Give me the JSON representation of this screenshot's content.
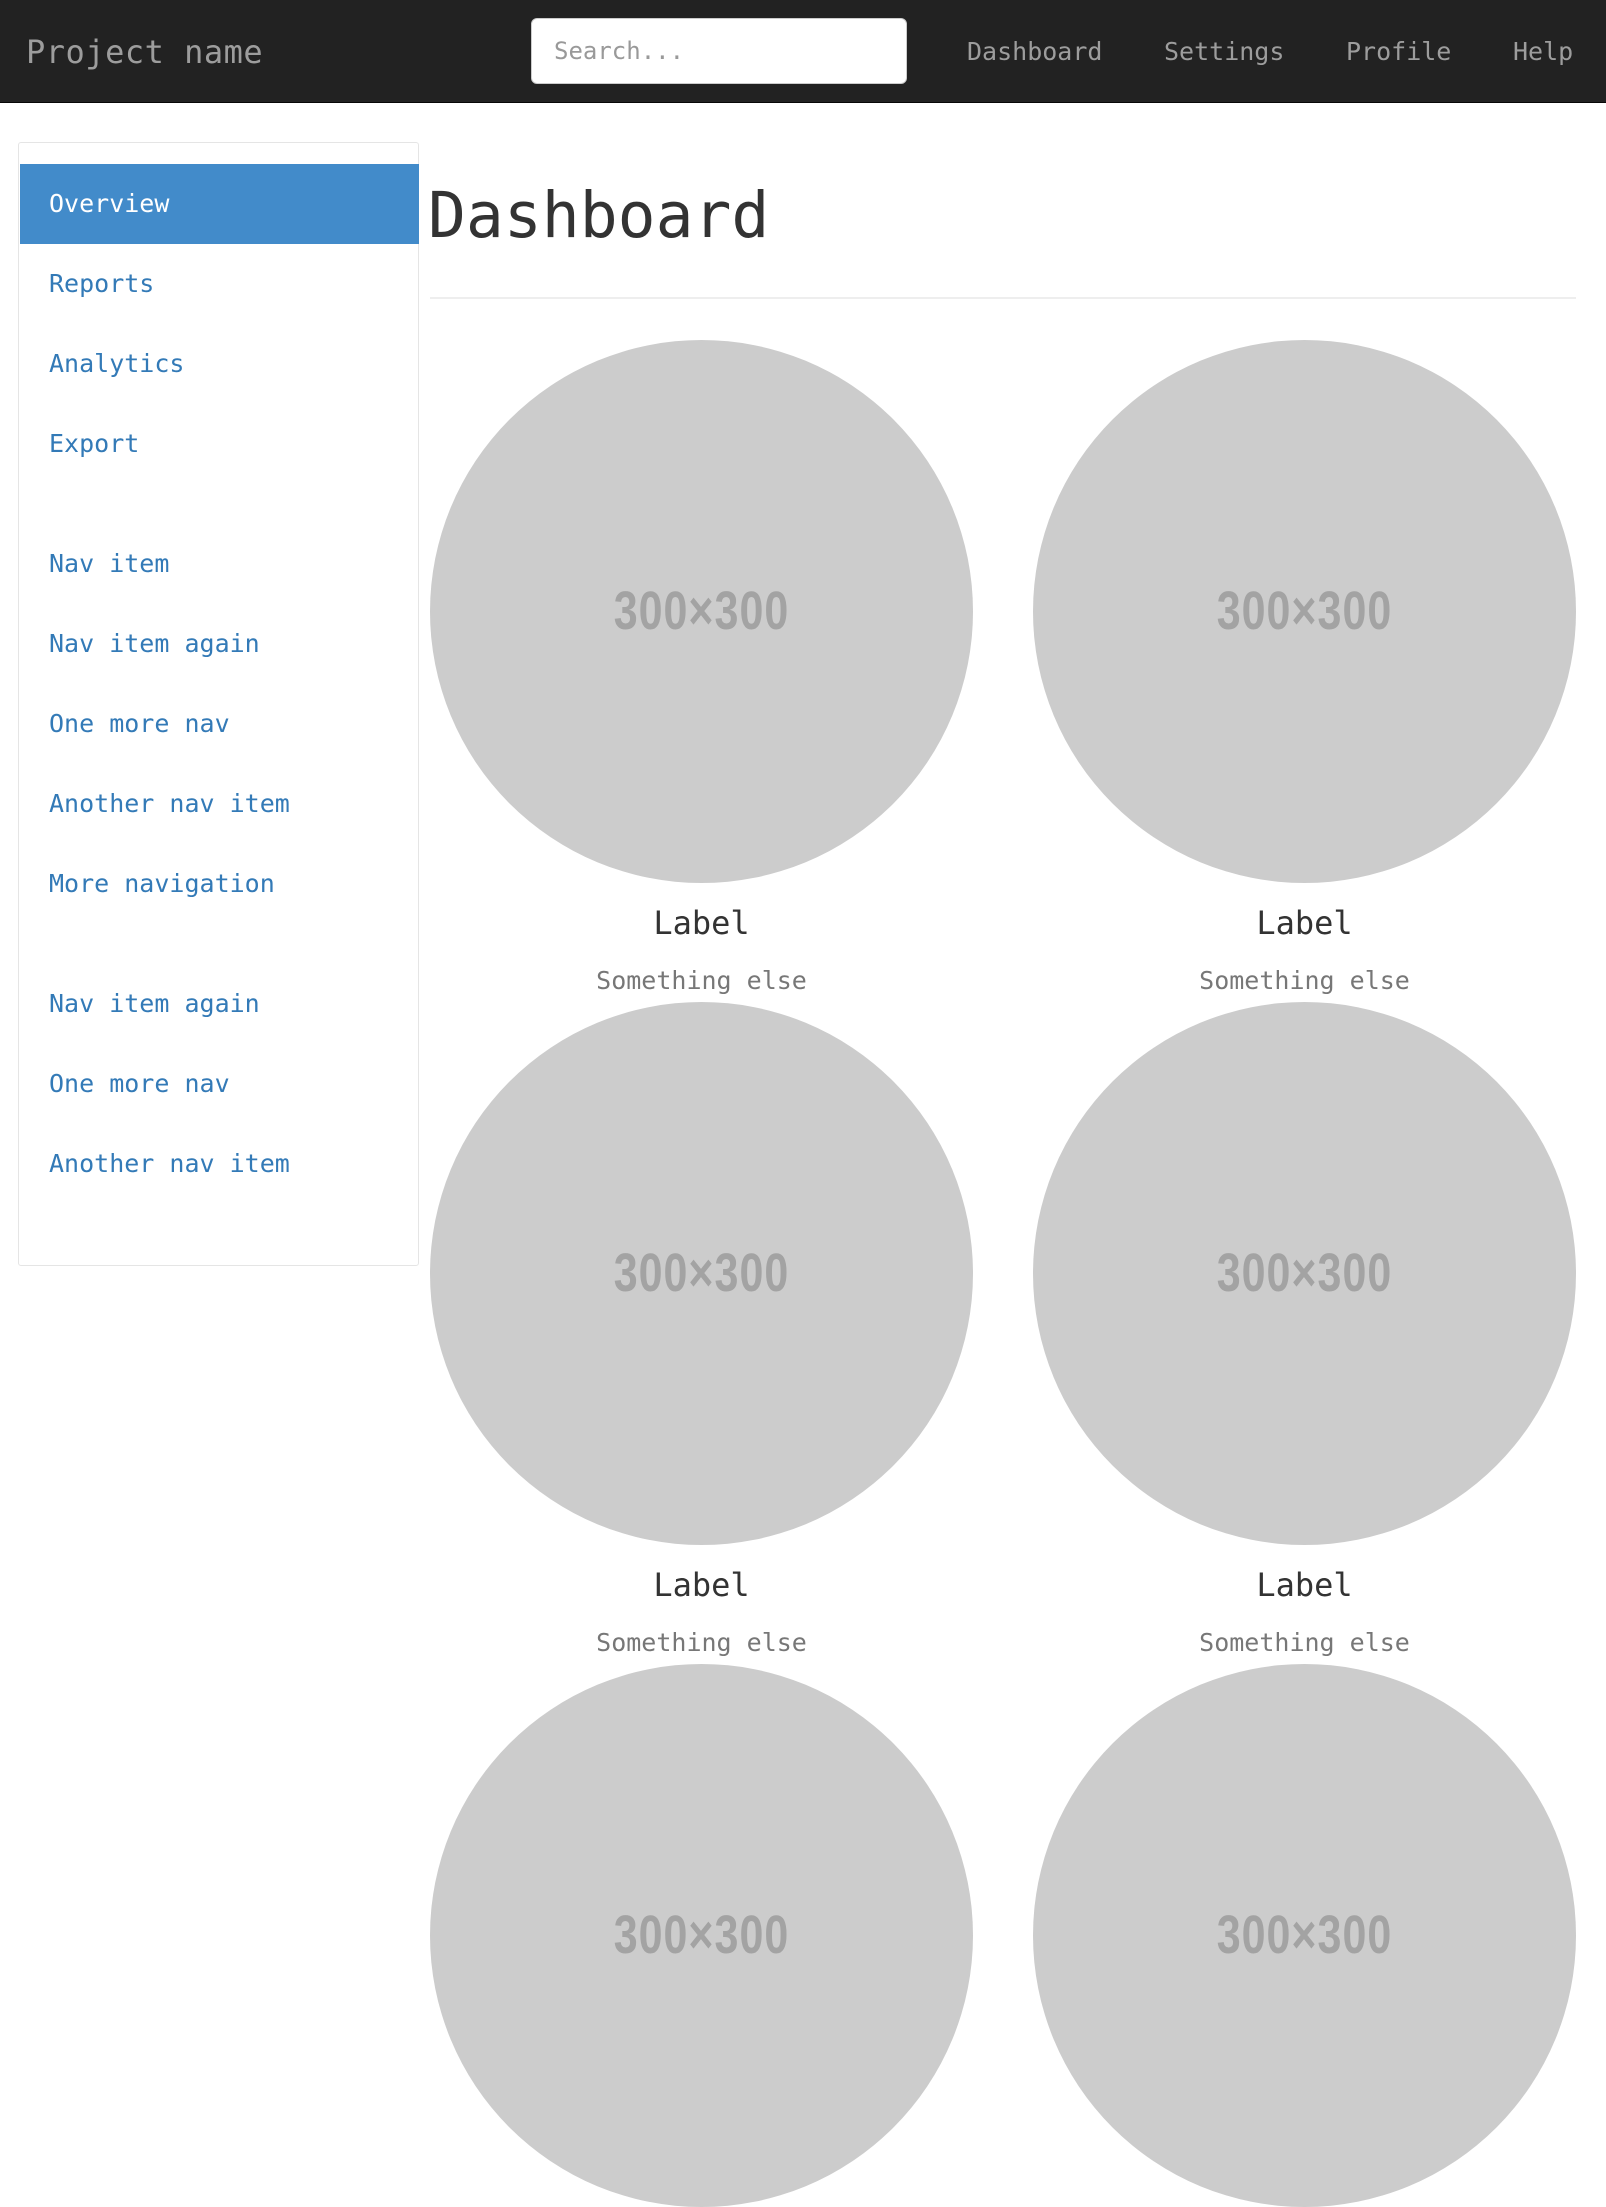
{
  "navbar": {
    "brand": "Project name",
    "search_placeholder": "Search...",
    "links": [
      "Dashboard",
      "Settings",
      "Profile",
      "Help"
    ]
  },
  "sidebar": {
    "groups": [
      [
        "Overview",
        "Reports",
        "Analytics",
        "Export"
      ],
      [
        "Nav item",
        "Nav item again",
        "One more nav",
        "Another nav item",
        "More navigation"
      ],
      [
        "Nav item again",
        "One more nav",
        "Another nav item"
      ]
    ],
    "active": "Overview"
  },
  "main": {
    "title": "Dashboard",
    "placeholders": [
      {
        "image_text": "300×300",
        "label": "Label",
        "sub": "Something else"
      },
      {
        "image_text": "300×300",
        "label": "Label",
        "sub": "Something else"
      },
      {
        "image_text": "300×300",
        "label": "Label",
        "sub": "Something else"
      },
      {
        "image_text": "300×300",
        "label": "Label",
        "sub": "Something else"
      },
      {
        "image_text": "300×300"
      },
      {
        "image_text": "300×300"
      }
    ]
  },
  "colors": {
    "navbar_bg": "#222222",
    "active_bg": "#428bca",
    "link": "#337ab7",
    "placeholder_bg": "#cccccc"
  }
}
